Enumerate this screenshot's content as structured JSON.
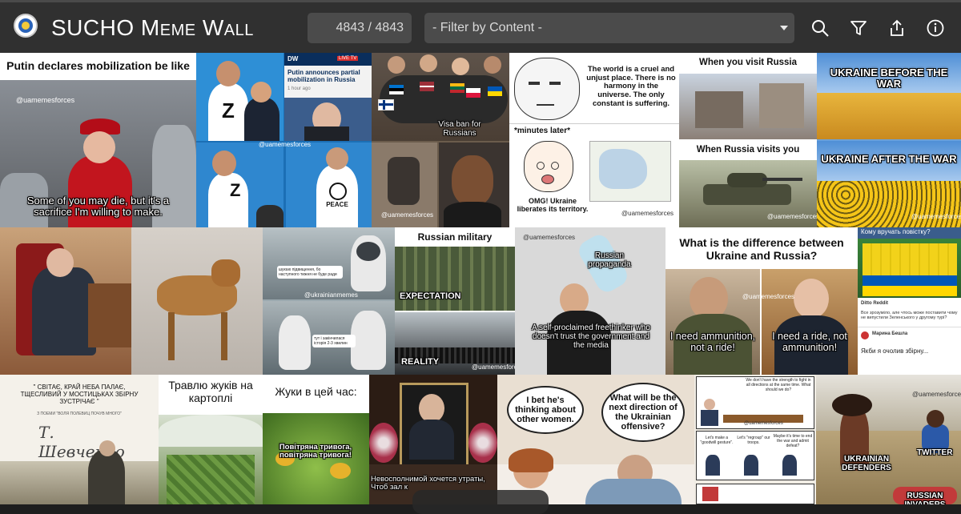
{
  "header": {
    "title_main": "SUCHO ",
    "title_sc": "Meme Wall",
    "counter": "4843 / 4843",
    "filter_placeholder": "- Filter by Content -",
    "icons": [
      "search-icon",
      "filter-icon",
      "share-icon",
      "info-icon"
    ]
  },
  "colors": {
    "header_bg": "#303030",
    "input_bg": "#4b4b4b",
    "text": "#d9d9d9"
  },
  "memes": {
    "m1": {
      "heading": "Putin declares mobilization be like",
      "caption": "Some of you may die, but it's a sacrifice I'm willing to make.",
      "watermark": "@uamemesforces"
    },
    "m2": {
      "channel": "DW",
      "live": "LIVE TV",
      "headline": "Putin announces partial mobilization in Russia",
      "time": "1 hour ago",
      "letter": "Z",
      "peace": "PEACE",
      "watermark": "@uamemesforces"
    },
    "m3": {
      "caption": "Visa ban for Russians",
      "watermark": "@uamemesforces"
    },
    "m4": {
      "top_text": "The world is a cruel and unjust place. There is no harmony in the universe. The only constant is suffering.",
      "minutes": "*minutes later*",
      "bottom_text": "OMG! Ukraine liberates its territory.",
      "watermark": "@uamemesforces"
    },
    "m5": {
      "top": "When you visit Russia",
      "bottom": "When Russia visits you",
      "watermark": "@uamemesforces"
    },
    "m6": {
      "top": "UKRAINE BEFORE THE WAR",
      "bottom": "UKRAINE AFTER THE WAR",
      "watermark": "@uamemesforces"
    },
    "m8": {
      "text_a": "шукаю підвищення, бо наступного тижня не буде ради",
      "text_b": "тут і закінчилася історія 2-3 хвилин",
      "watermark": "@ukrainianmemes"
    },
    "m9": {
      "heading": "Russian military",
      "expect": "EXPECTATION",
      "reality": "REALITY",
      "watermark": "@uamemesforces"
    },
    "m10": {
      "top": "Russian propaganda",
      "bottom": "A self-proclaimed freethinker who doesn't trust the government and the media",
      "watermark": "@uamemesforces"
    },
    "m11": {
      "heading": "What is the difference between Ukraine and Russia?",
      "left": "I need ammunition, not a ride!",
      "right": "I need a ride, not ammunition!",
      "watermark": "@uamemesforces"
    },
    "m12": {
      "question": "Кому вручать повістку?",
      "post_author": "Ditto Reddit",
      "post_text": "Все зрозуміло, але чтось може поставити чому не випустили Зеленського у другому турі?",
      "reply_author": "Марина Бешла",
      "reply_text": "Якби я очолив збірну..."
    },
    "m13": {
      "quote": "\" СВІТАЄ, КРАЙ НЕБА ПАЛАЄ, ТЩЕСЛИВИЙ У МОСТИЦЬКАХ ЗБІРНУ ЗУСТРІЧАЄ \"",
      "sub": "З ПОЕМИ \"ВОЛЯ ПОЛЕВИЦ ПОЧУВ МНОГО\"",
      "signature": "Т. Шевченко"
    },
    "m14": {
      "heading": "Травлю жуків на картоплі"
    },
    "m15": {
      "heading": "Жуки в цей час:",
      "caption": "Повітряна тривога, повітряна тривога!"
    },
    "m16": {
      "caption": "Невосполнимой хочется утраты, Чтоб зал к"
    },
    "m17": {
      "left": "I bet he's thinking about other women.",
      "right": "What will be the next direction of the Ukrainian offensive?"
    },
    "m18": {
      "top": "We don't have the strength to fight in all directions at the same time. What should we do?",
      "b1": "Let's make a \"goodwill gesture\".",
      "b2": "Let's \"regroup\" our troops.",
      "b3": "Maybe it's time to end the war and admit defeat?",
      "watermark": "@uamemesforces"
    },
    "m19": {
      "defenders": "UKRAINIAN DEFENDERS",
      "twitter": "TWITTER",
      "invaders": "RUSSIAN INVADERS",
      "watermark": "@uamemesforces"
    }
  }
}
